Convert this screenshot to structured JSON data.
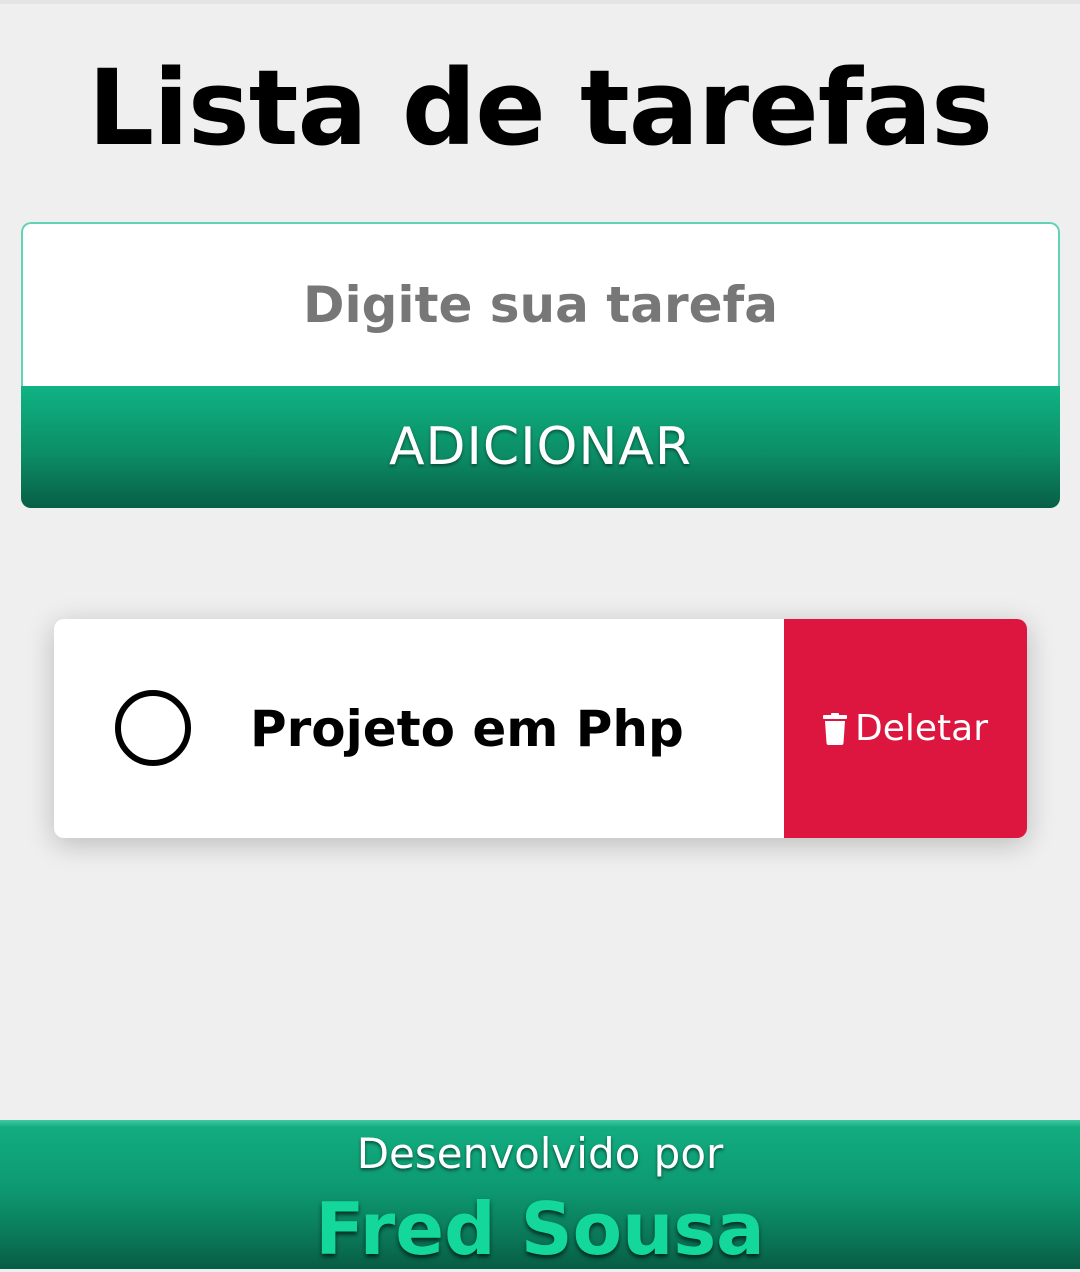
{
  "header": {
    "title": "Lista de tarefas"
  },
  "form": {
    "input_placeholder": "Digite sua tarefa",
    "input_value": "",
    "add_button_label": "ADICIONAR"
  },
  "tasks": [
    {
      "text": "Projeto em Php",
      "completed": false,
      "check_icon": "circle-outline-icon",
      "delete_label": "Deletar",
      "delete_icon": "trash-icon"
    }
  ],
  "footer": {
    "label": "Desenvolvido por",
    "author": "Fred Sousa"
  },
  "colors": {
    "background": "#efefef",
    "accent_green": "#0fb384",
    "accent_green_dark": "#075f45",
    "delete_red": "#dc163f",
    "author_green": "#14d79c",
    "input_border": "#5fd3b4"
  }
}
